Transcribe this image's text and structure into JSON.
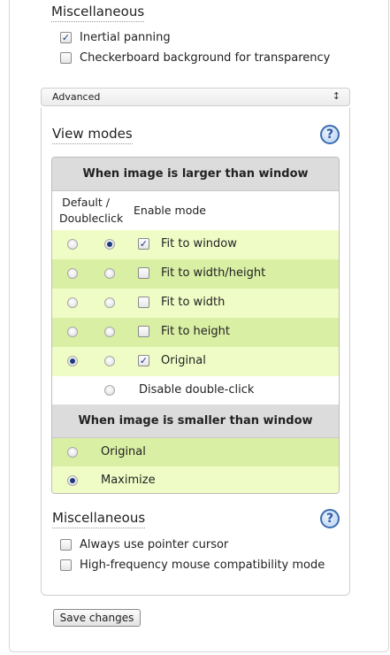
{
  "top_section": {
    "heading": "Miscellaneous",
    "options": [
      {
        "label": "Inertial panning",
        "checked": true
      },
      {
        "label": "Checkerboard background for transparency",
        "checked": false
      }
    ]
  },
  "advanced": {
    "title": "Advanced",
    "collapse_icon": "↕"
  },
  "view_modes": {
    "heading": "View modes",
    "help_icon": "?",
    "larger_header": "When image is larger than window",
    "col_default": "Default / Doubleclick",
    "col_enable": "Enable mode",
    "larger_rows": [
      {
        "label": "Fit to window",
        "default": false,
        "doubleclick": true,
        "enabled": true
      },
      {
        "label": "Fit to width/height",
        "default": false,
        "doubleclick": false,
        "enabled": false
      },
      {
        "label": "Fit to width",
        "default": false,
        "doubleclick": false,
        "enabled": false
      },
      {
        "label": "Fit to height",
        "default": false,
        "doubleclick": false,
        "enabled": false
      },
      {
        "label": "Original",
        "default": true,
        "doubleclick": false,
        "enabled": true
      }
    ],
    "disable_doubleclick": {
      "label": "Disable double-click",
      "selected": false
    },
    "smaller_header": "When image is smaller than window",
    "smaller_rows": [
      {
        "label": "Original",
        "selected": false
      },
      {
        "label": "Maximize",
        "selected": true
      }
    ]
  },
  "misc_section": {
    "heading": "Miscellaneous",
    "help_icon": "?",
    "options": [
      {
        "label": "Always use pointer cursor",
        "checked": false
      },
      {
        "label": "High-frequency mouse compatibility mode",
        "checked": false
      }
    ]
  },
  "save_label": "Save changes",
  "colors": {
    "row_light": "#f0fcc6",
    "row_dark": "#d8efa4",
    "header_gray": "#dcdcdc",
    "radio_dot": "#1e3a7a",
    "help_blue": "#3b6fb0"
  }
}
